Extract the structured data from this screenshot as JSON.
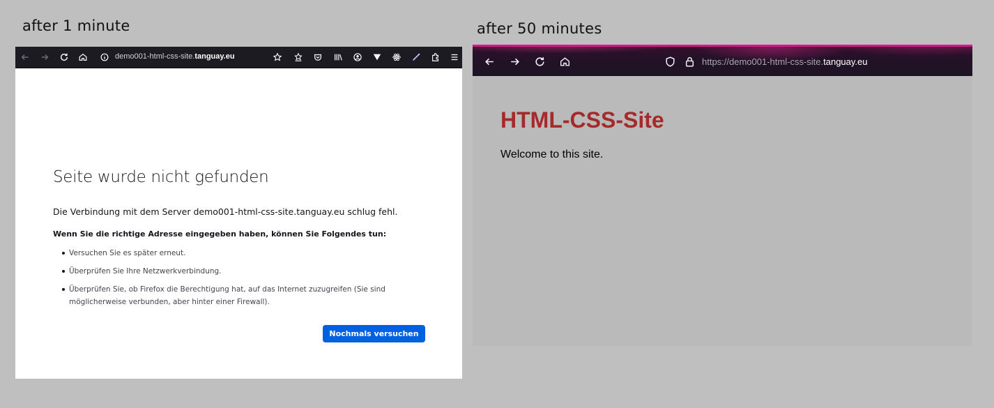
{
  "captions": {
    "left": "after 1 minute",
    "right": "after 50 minutes"
  },
  "left_window": {
    "url_prefix": "demo001-html-css-site.",
    "url_domain": "tanguay.eu",
    "error": {
      "title": "Seite wurde nicht gefunden",
      "message": "Die Verbindung mit dem Server demo001-html-css-site.tanguay.eu schlug fehl.",
      "hint": "Wenn Sie die richtige Adresse eingegeben haben, können Sie Folgendes tun:",
      "items": [
        "Versuchen Sie es später erneut.",
        "Überprüfen Sie Ihre Netzwerkverbindung.",
        "Überprüfen Sie, ob Firefox die Berechtigung hat, auf das Internet zuzugreifen (Sie sind möglicherweise verbunden, aber hinter einer Firewall)."
      ],
      "retry_label": "Nochmals versuchen"
    },
    "toolbar_icons": [
      "back-arrow-icon",
      "forward-arrow-icon",
      "reload-icon",
      "home-icon",
      "info-icon",
      "bookmark-star-icon",
      "reading-list-icon",
      "pocket-icon",
      "library-icon",
      "account-icon",
      "vpn-icon",
      "react-devtools-icon",
      "pen-icon",
      "extensions-icon",
      "menu-icon"
    ]
  },
  "right_window": {
    "url_prefix": "https://demo001-html-css-site.",
    "url_domain": "tanguay.eu",
    "page": {
      "title": "HTML-CSS-Site",
      "text": "Welcome to this site."
    },
    "toolbar_icons": [
      "back-arrow-icon",
      "forward-arrow-icon",
      "reload-icon",
      "home-icon",
      "shield-icon",
      "lock-icon"
    ]
  },
  "colors": {
    "page_background": "#bfbfbf",
    "dark_toolbar": "#1c1b22",
    "retry_button": "#0061e0",
    "site_title": "#a52a2a",
    "theme_accent": "#d41a8c"
  }
}
